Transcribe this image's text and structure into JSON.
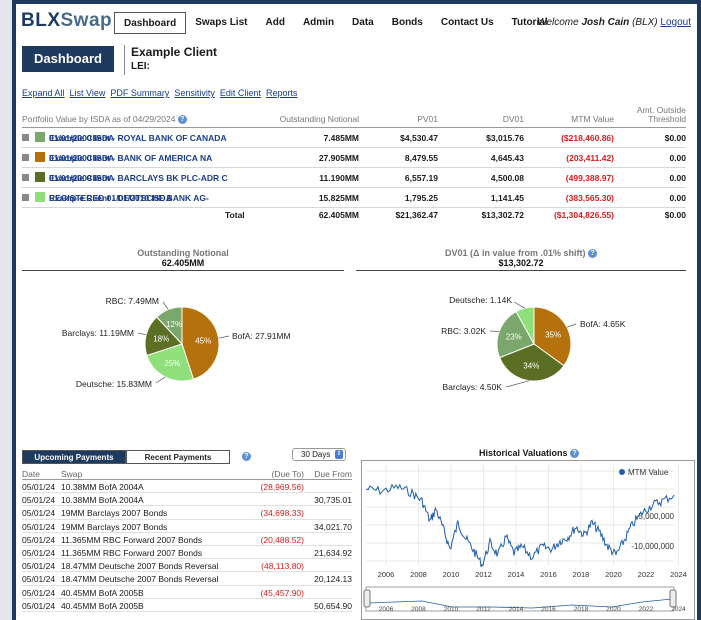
{
  "nav": {
    "logo_main": "BLX",
    "logo_sub": "Swap",
    "items": [
      "Dashboard",
      "Swaps List",
      "Add",
      "Admin",
      "Data",
      "Bonds",
      "Contact Us",
      "Tutorial"
    ],
    "welcome_prefix": "Welcome",
    "user": "Josh Cain",
    "org": "(BLX)",
    "logout": "Logout"
  },
  "header": {
    "dashboard_label": "Dashboard",
    "client_name": "Example Client",
    "lei_label": "LEI:"
  },
  "links": [
    "Expand All",
    "List View",
    "PDF Summary",
    "Sensitivity",
    "Edit Client",
    "Reports"
  ],
  "portfolio": {
    "title": "Portfolio Value by ISDA as of 04/29/2024",
    "columns": {
      "notional": "Outstanding Notional",
      "pv01": "PV01",
      "dv01": "DV01",
      "mtm": "MTM Value",
      "amt1": "Amt. Outside",
      "amt2": "Threshold"
    },
    "rows": [
      {
        "name1": "Example Client - ROYAL BANK OF CANADA",
        "name2": "01/01/2000 ISDA",
        "color": "#7aa76b",
        "notional": "7.485MM",
        "pv01": "$4,530.47",
        "dv01": "$3,015.76",
        "mtm": "($218,460.86)",
        "amt": "$0.00"
      },
      {
        "name1": "Example Client - BANK OF AMERICA NA",
        "name2": "01/01/2000 ISDA",
        "color": "#b5720c",
        "notional": "27.905MM",
        "pv01": "8,479.55",
        "dv01": "4,645.43",
        "mtm": "(203,411.42)",
        "amt": "0.00"
      },
      {
        "name1": "Example Client - BARCLAYS BK PLC-ADR C",
        "name2": "01/01/2009 ISDA",
        "color": "#5b6f24",
        "notional": "11.190MM",
        "pv01": "6,557.19",
        "dv01": "4,500.08",
        "mtm": "(499,388.97)",
        "amt": "0.00"
      },
      {
        "name1": "Example Client - DEUTSCHE BANK AG-",
        "name2": "REGISTERED 01/01/2010 ISDA",
        "color": "#8fe07a",
        "notional": "15.825MM",
        "pv01": "1,795.25",
        "dv01": "1,141.45",
        "mtm": "(383,565.30)",
        "amt": "0.00"
      }
    ],
    "total": {
      "label": "Total",
      "notional": "62.405MM",
      "pv01": "$21,362.47",
      "dv01": "$13,302.72",
      "mtm": "($1,304,826.55)",
      "amt": "$0.00"
    }
  },
  "pie_notional": {
    "title": "Outstanding Notional",
    "value": "62.405MM",
    "slices": [
      {
        "label": "BofA: 27.91MM",
        "pct": "45%",
        "value": 45,
        "color": "#b5720c"
      },
      {
        "label": "Deutsche: 15.83MM",
        "pct": "25%",
        "value": 25,
        "color": "#8fe07a"
      },
      {
        "label": "Barclays: 11.19MM",
        "pct": "18%",
        "value": 18,
        "color": "#5b6f24"
      },
      {
        "label": "RBC: 7.49MM",
        "pct": "12%",
        "value": 12,
        "color": "#7aa76b"
      }
    ]
  },
  "pie_dv01": {
    "title": "DV01 (Δ in value from .01% shift)",
    "value": "$13,302.72",
    "slices": [
      {
        "label": "BofA: 4.65K",
        "pct": "35%",
        "value": 35,
        "color": "#b5720c"
      },
      {
        "label": "Barclays: 4.50K",
        "pct": "34%",
        "value": 34,
        "color": "#5b6f24"
      },
      {
        "label": "RBC: 3.02K",
        "pct": "23%",
        "value": 23,
        "color": "#7aa76b"
      },
      {
        "label": "Deutsche: 1.14K",
        "pct": "",
        "value": 8,
        "color": "#8fe07a"
      }
    ]
  },
  "payments": {
    "tab_upcoming": "Upcoming Payments",
    "tab_recent": "Recent Payments",
    "range": "30 Days",
    "headers": {
      "date": "Date",
      "swap": "Swap",
      "due_to": "(Due To)",
      "due_from": "Due From"
    },
    "rows": [
      {
        "date": "05/01/24",
        "swap": "10.38MM BofA 2004A",
        "due_to": "(28,969.56)",
        "due_from": ""
      },
      {
        "date": "05/01/24",
        "swap": "10.38MM BofA 2004A",
        "due_to": "",
        "due_from": "30,735.01"
      },
      {
        "date": "05/01/24",
        "swap": "19MM Barclays 2007 Bonds",
        "due_to": "(34,698.33)",
        "due_from": ""
      },
      {
        "date": "05/01/24",
        "swap": "19MM Barclays 2007 Bonds",
        "due_to": "",
        "due_from": "34,021.70"
      },
      {
        "date": "05/01/24",
        "swap": "11.365MM RBC Forward 2007 Bonds",
        "due_to": "(20,488.52)",
        "due_from": ""
      },
      {
        "date": "05/01/24",
        "swap": "11.365MM RBC Forward 2007 Bonds",
        "due_to": "",
        "due_from": "21,634.92"
      },
      {
        "date": "05/01/24",
        "swap": "18.47MM Deutsche 2007 Bonds Reversal",
        "due_to": "(48,113.80)",
        "due_from": ""
      },
      {
        "date": "05/01/24",
        "swap": "18.47MM Deutsche 2007 Bonds Reversal",
        "due_to": "",
        "due_from": "20,124.13"
      },
      {
        "date": "05/01/24",
        "swap": "40.45MM BofA 2005B",
        "due_to": "(45,457.90)",
        "due_from": ""
      },
      {
        "date": "05/01/24",
        "swap": "40.45MM BofA 2005B",
        "due_to": "",
        "due_from": "50,654.90"
      }
    ]
  },
  "historical": {
    "title": "Historical Valuations",
    "legend": "MTM Value",
    "yticks": [
      "-5,000,000",
      "-10,000,000"
    ],
    "xticks": [
      "2006",
      "2008",
      "2010",
      "2012",
      "2014",
      "2016",
      "2018",
      "2020",
      "2022",
      "2024"
    ],
    "nav_ticks": [
      "2006",
      "2008",
      "2010",
      "2012",
      "2014",
      "2016",
      "2018",
      "2020",
      "2022",
      "2024"
    ],
    "line_color": "#1f5fa8"
  }
}
